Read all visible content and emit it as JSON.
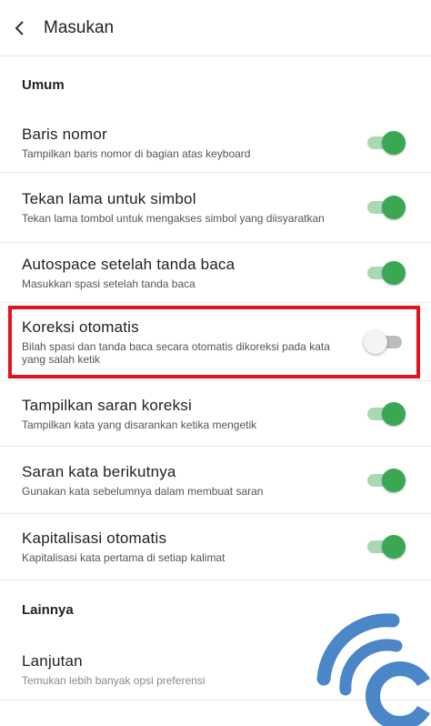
{
  "app_bar": {
    "title": "Masukan",
    "back_icon": "chevron-left-icon"
  },
  "sections": {
    "umum": "Umum",
    "lainnya": "Lainnya"
  },
  "settings": [
    {
      "label": "Baris nomor",
      "desc": "Tampilkan baris nomor di bagian atas keyboard",
      "on": true
    },
    {
      "label": "Tekan lama untuk simbol",
      "desc": "Tekan lama tombol untuk mengakses simbol yang diisyaratkan",
      "on": true
    },
    {
      "label": "Autospace setelah tanda baca",
      "desc": "Masukkan spasi setelah tanda baca",
      "on": true
    },
    {
      "label": "Koreksi otomatis",
      "desc": "Bilah spasi dan tanda baca secara otomatis dikoreksi pada kata yang salah ketik",
      "on": false
    },
    {
      "label": "Tampilkan saran koreksi",
      "desc": "Tampilkan kata yang disarankan ketika mengetik",
      "on": true
    },
    {
      "label": "Saran kata berikutnya",
      "desc": "Gunakan kata sebelumnya dalam membuat saran",
      "on": true
    },
    {
      "label": "Kapitalisasi otomatis",
      "desc": "Kapitalisasi kata pertama di setiap kalimat",
      "on": true
    }
  ],
  "lanjutan": {
    "label": "Lanjutan",
    "desc": "Temukan lebih banyak opsi preferensi"
  },
  "colors": {
    "toggle_on": "#3aa853",
    "highlight": "#e3131d",
    "watermark": "#4a86c8"
  }
}
